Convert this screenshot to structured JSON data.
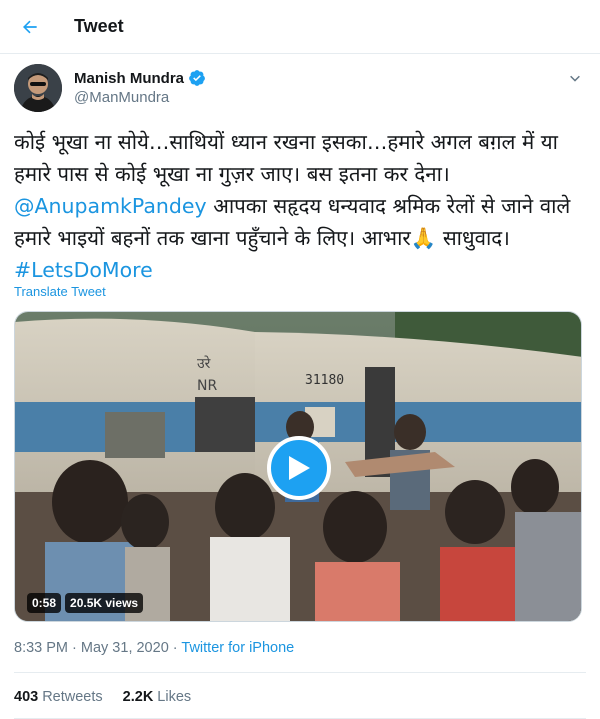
{
  "header": {
    "title": "Tweet"
  },
  "author": {
    "display_name": "Manish Mundra",
    "handle": "@ManMundra"
  },
  "tweet": {
    "text_part1": "कोई भूखा ना सोये…साथियों ध्यान रखना इसका…हमारे अगल बग़ल में या हमारे पास से कोई भूखा ना गुज़र जाए। बस इतना कर देना। ",
    "mention": "@AnupamkPandey",
    "text_part2": "  आपका सहृदय धन्यवाद श्रमिक रेलों से जाने वाले हमारे भाइयों बहनों तक खाना पहुँचाने के लिए। आभार🙏 साधुवाद। ",
    "hashtag": "#LetsDoMore",
    "translate_label": "Translate Tweet"
  },
  "video": {
    "duration": "0:58",
    "views": "20.5K views",
    "coach_code": "31180",
    "coach_marking": "उरे",
    "coach_marking2": "NR"
  },
  "meta": {
    "time": "8:33 PM",
    "separator": " · ",
    "date": "May 31, 2020",
    "source": "Twitter for iPhone"
  },
  "stats": {
    "retweets_count": "403",
    "retweets_label": "Retweets",
    "likes_count": "2.2K",
    "likes_label": "Likes"
  },
  "colors": {
    "accent": "#1da1f2",
    "link": "#1b95e0",
    "text": "#14171a",
    "secondary": "#657786"
  }
}
